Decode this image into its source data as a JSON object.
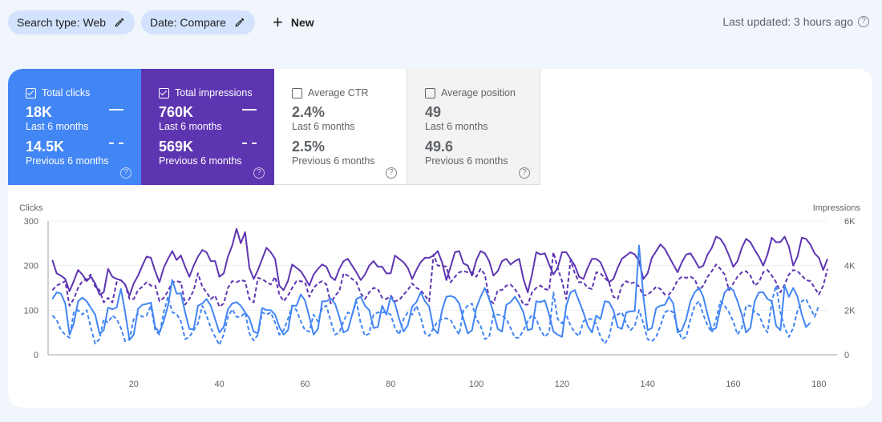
{
  "toolbar": {
    "chips": [
      {
        "label": "Search type: Web",
        "icon": "pencil-icon"
      },
      {
        "label": "Date: Compare",
        "icon": "pencil-icon"
      }
    ],
    "new_label": "New",
    "new_icon": "plus-icon",
    "last_updated": "Last updated: 3 hours ago",
    "help_glyph": "?"
  },
  "metrics": [
    {
      "name": "Total clicks",
      "checked": true,
      "current": "18K",
      "current_label": "Last 6 months",
      "previous": "14.5K",
      "previous_label": "Previous 6 months",
      "color": "#4285f4"
    },
    {
      "name": "Total impressions",
      "checked": true,
      "current": "760K",
      "current_label": "Last 6 months",
      "previous": "569K",
      "previous_label": "Previous 6 months",
      "color": "#5e35b1"
    },
    {
      "name": "Average CTR",
      "checked": false,
      "current": "2.4%",
      "current_label": "Last 6 months",
      "previous": "2.5%",
      "previous_label": "Previous 6 months",
      "color": "#ffffff"
    },
    {
      "name": "Average position",
      "checked": false,
      "current": "49",
      "current_label": "Last 6 months",
      "previous": "49.6",
      "previous_label": "Previous 6 months",
      "color": "#f3f3f3"
    }
  ],
  "chart_data": {
    "type": "line",
    "title": "",
    "xlabel": "",
    "ylabel": "Clicks",
    "y2label": "Impressions",
    "xlim": [
      0,
      182
    ],
    "ylim": [
      0,
      300
    ],
    "y2lim": [
      0,
      6000
    ],
    "x_ticks": [
      20,
      40,
      60,
      80,
      100,
      120,
      140,
      160,
      180
    ],
    "y_ticks": [
      0,
      100,
      200,
      300
    ],
    "y_tick_labels": [
      "0",
      "100",
      "200",
      "300"
    ],
    "y2_ticks": [
      0,
      2000,
      4000,
      6000
    ],
    "y2_tick_labels": [
      "0",
      "2K",
      "4K",
      "6K"
    ],
    "grid": true,
    "series": [
      {
        "name": "Total impressions (Last 6 months)",
        "axis": "right",
        "style": "solid",
        "color": "#5e35b1",
        "values": [
          4250,
          3650,
          3550,
          3400,
          2850,
          3300,
          3800,
          3600,
          3300,
          3500,
          3200,
          2700,
          2800,
          3850,
          3500,
          3400,
          3350,
          3150,
          2650,
          3200,
          3550,
          4000,
          4400,
          4350,
          3750,
          3250,
          3900,
          4300,
          4650,
          4250,
          4450,
          3950,
          3500,
          4000,
          4400,
          4700,
          4600,
          4200,
          4200,
          3500,
          3650,
          4400,
          4900,
          5650,
          5000,
          5500,
          3900,
          3400,
          3800,
          4300,
          4800,
          4600,
          4300,
          3100,
          2900,
          3300,
          4050,
          3900,
          3750,
          3450,
          3100,
          3600,
          3850,
          4050,
          3950,
          3500,
          3350,
          3850,
          4200,
          4300,
          4000,
          3700,
          3350,
          3600,
          4000,
          4200,
          3950,
          3950,
          3650,
          3650,
          4450,
          4300,
          4150,
          3900,
          3400,
          3800,
          4150,
          4350,
          4350,
          4450,
          4650,
          4150,
          3350,
          3950,
          4600,
          4650,
          4100,
          4000,
          3550,
          4250,
          4650,
          4550,
          4200,
          3550,
          3750,
          4200,
          4300,
          4050,
          4200,
          4300,
          3400,
          2800,
          3600,
          4600,
          4500,
          4550,
          4050,
          3600,
          3900,
          4600,
          4600,
          4300,
          4000,
          3500,
          3400,
          3900,
          4300,
          4300,
          4150,
          3700,
          3250,
          3400,
          3900,
          4300,
          4450,
          4600,
          4500,
          4200,
          3400,
          3650,
          4350,
          4650,
          4950,
          4750,
          4400,
          4050,
          3700,
          4150,
          4500,
          4550,
          4250,
          3900,
          4000,
          4500,
          4800,
          5300,
          5200,
          4900,
          4450,
          3950,
          4200,
          4800,
          5200,
          5050,
          4700,
          4400,
          4000,
          4500,
          5250,
          5050,
          5050,
          5300,
          4850,
          4000,
          4400,
          5250,
          5200,
          4950,
          4550,
          4350,
          3800,
          4300
        ]
      },
      {
        "name": "Total impressions (Previous 6 months)",
        "axis": "right",
        "style": "dashed",
        "color": "#5e35b1",
        "values": [
          2900,
          3100,
          3200,
          3300,
          2200,
          2500,
          3000,
          3300,
          3400,
          3600,
          3050,
          2900,
          2350,
          2550,
          2350,
          3250,
          3350,
          3150,
          2500,
          2500,
          2900,
          3050,
          3250,
          3100,
          3100,
          2400,
          2550,
          2850,
          3250,
          3300,
          3250,
          2250,
          2500,
          2900,
          3650,
          3050,
          2800,
          2500,
          2650,
          2150,
          2300,
          3000,
          3300,
          3250,
          3350,
          3300,
          2500,
          2350,
          3450,
          3400,
          3250,
          3150,
          3500,
          2700,
          2400,
          2650,
          3000,
          3300,
          3300,
          3250,
          2600,
          3000,
          3200,
          3300,
          3150,
          2300,
          2650,
          2850,
          3650,
          3550,
          3400,
          3250,
          2750,
          2500,
          2800,
          3000,
          2950,
          2550,
          2500,
          2650,
          2400,
          2450,
          2700,
          2900,
          3200,
          3000,
          2900,
          2650,
          2400,
          4500,
          4000,
          4000,
          3950,
          3250,
          3500,
          3700,
          3750,
          3700,
          3700,
          3500,
          3850,
          3600,
          2500,
          2300,
          2900,
          2900,
          3100,
          3150,
          2950,
          2650,
          2250,
          2250,
          2800,
          3000,
          3100,
          2950,
          2900,
          4600,
          3900,
          3300,
          2500,
          4250,
          3650,
          3250,
          3250,
          3000,
          2950,
          3700,
          3650,
          3450,
          3250,
          2600,
          2500,
          3100,
          3300,
          3200,
          3250,
          3050,
          2650,
          2700,
          2850,
          3050,
          2950,
          2700,
          2700,
          2950,
          3350,
          3500,
          3450,
          3500,
          3400,
          2900,
          3100,
          3500,
          3750,
          4050,
          3850,
          3600,
          2900,
          3200,
          3500,
          3700,
          3750,
          3550,
          3100,
          3250,
          3700,
          3800,
          3550,
          3250,
          2800,
          3150,
          3600,
          3800,
          3750,
          3550,
          3350,
          3300,
          3000,
          2700,
          3100,
          3850
        ]
      },
      {
        "name": "Total clicks (Last 6 months)",
        "axis": "left",
        "style": "solid",
        "color": "#4285f4",
        "values": [
          125,
          140,
          137,
          115,
          45,
          70,
          120,
          128,
          120,
          105,
          90,
          48,
          55,
          106,
          102,
          106,
          148,
          95,
          33,
          45,
          103,
          112,
          114,
          117,
          62,
          50,
          75,
          110,
          168,
          137,
          138,
          95,
          58,
          57,
          110,
          115,
          125,
          110,
          80,
          50,
          62,
          102,
          115,
          118,
          110,
          95,
          82,
          52,
          48,
          105,
          100,
          100,
          90,
          62,
          45,
          55,
          110,
          110,
          135,
          122,
          85,
          45,
          58,
          120,
          120,
          126,
          115,
          85,
          50,
          55,
          90,
          125,
          130,
          110,
          100,
          60,
          62,
          110,
          90,
          130,
          115,
          80,
          52,
          66,
          108,
          118,
          140,
          120,
          108,
          58,
          48,
          100,
          130,
          132,
          128,
          115,
          80,
          48,
          55,
          105,
          130,
          150,
          125,
          95,
          58,
          52,
          112,
          118,
          130,
          115,
          95,
          55,
          58,
          120,
          118,
          122,
          90,
          52,
          45,
          40,
          110,
          140,
          145,
          120,
          95,
          65,
          50,
          88,
          80,
          120,
          118,
          100,
          62,
          58,
          95,
          97,
          98,
          245,
          130,
          55,
          60,
          105,
          110,
          112,
          130,
          115,
          50,
          55,
          80,
          120,
          140,
          150,
          130,
          90,
          55,
          60,
          105,
          140,
          150,
          145,
          120,
          90,
          50,
          60,
          120,
          140,
          140,
          125,
          120,
          65,
          55,
          155,
          130,
          150,
          130,
          90,
          62,
          72
        ]
      },
      {
        "name": "Total clicks (Previous 6 months)",
        "axis": "left",
        "style": "dashed",
        "color": "#4285f4",
        "values": [
          88,
          78,
          55,
          45,
          38,
          95,
          100,
          90,
          100,
          60,
          25,
          35,
          80,
          72,
          88,
          80,
          60,
          30,
          35,
          80,
          92,
          85,
          88,
          110,
          55,
          45,
          95,
          130,
          95,
          92,
          75,
          35,
          40,
          55,
          70,
          110,
          88,
          60,
          40,
          22,
          45,
          85,
          102,
          85,
          85,
          95,
          48,
          32,
          45,
          95,
          90,
          95,
          72,
          45,
          55,
          80,
          110,
          100,
          75,
          55,
          52,
          90,
          75,
          105,
          110,
          75,
          45,
          50,
          75,
          95,
          90,
          120,
          70,
          42,
          48,
          90,
          95,
          95,
          95,
          90,
          60,
          45,
          80,
          95,
          90,
          110,
          85,
          48,
          42,
          60,
          75,
          80,
          82,
          78,
          60,
          45,
          100,
          110,
          115,
          80,
          65,
          35,
          40,
          90,
          90,
          88,
          80,
          60,
          38,
          38,
          55,
          75,
          90,
          80,
          55,
          40,
          50,
          140,
          80,
          70,
          90,
          65,
          50,
          42,
          75,
          80,
          80,
          70,
          40,
          25,
          40,
          85,
          90,
          95,
          70,
          55,
          65,
          100,
          70,
          35,
          30,
          40,
          65,
          95,
          100,
          95,
          60,
          35,
          40,
          80,
          110,
          120,
          90,
          65,
          50,
          80,
          120,
          110,
          95,
          75,
          45,
          60,
          110,
          110,
          95,
          90,
          65,
          50,
          120,
          155,
          95,
          60,
          40,
          60,
          98,
          120,
          125,
          105,
          85,
          110
        ]
      }
    ]
  }
}
